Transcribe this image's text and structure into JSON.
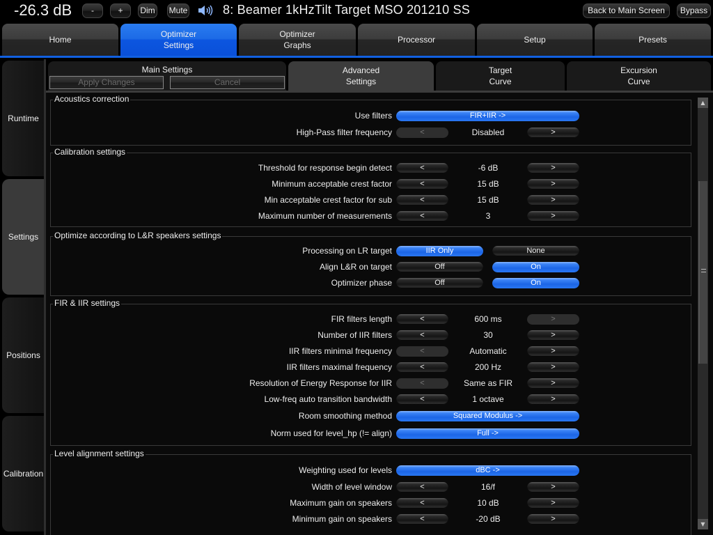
{
  "topbar": {
    "volume": "-26.3 dB",
    "minus_label": "-",
    "plus_label": "+",
    "dim_label": "Dim",
    "mute_label": "Mute",
    "preset_title": "8: Beamer 1kHzTilt Target MSO 201210 SS",
    "back_label": "Back to Main Screen",
    "bypass_label": "Bypass"
  },
  "main_tabs": [
    {
      "line1": "",
      "line2": "Home"
    },
    {
      "line1": "Optimizer",
      "line2": "Settings"
    },
    {
      "line1": "Optimizer",
      "line2": "Graphs"
    },
    {
      "line1": "",
      "line2": "Processor"
    },
    {
      "line1": "",
      "line2": "Setup"
    },
    {
      "line1": "",
      "line2": "Presets"
    }
  ],
  "side_tabs": [
    "Runtime",
    "Settings",
    "Positions",
    "Calibration"
  ],
  "sub_tabs": {
    "main_settings": "Main Settings",
    "apply_changes": "Apply Changes",
    "cancel": "Cancel",
    "advanced_1": "Advanced",
    "advanced_2": "Settings",
    "target_1": "Target",
    "target_2": "Curve",
    "excursion_1": "Excursion",
    "excursion_2": "Curve"
  },
  "arrows": {
    "prev": "<",
    "next": ">"
  },
  "groups": {
    "acoustics": {
      "title": "Acoustics correction",
      "use_filters": {
        "label": "Use filters",
        "value": "FIR+IIR ->"
      },
      "highpass": {
        "label": "High-Pass filter frequency",
        "value": "Disabled"
      }
    },
    "calibration": {
      "title": "Calibration settings",
      "rows": [
        {
          "label": "Threshold for response begin detect",
          "value": "-6 dB"
        },
        {
          "label": "Minimum acceptable crest factor",
          "value": "15 dB"
        },
        {
          "label": "Min acceptable crest factor for sub",
          "value": "15 dB"
        },
        {
          "label": "Maximum number of measurements",
          "value": "3"
        }
      ]
    },
    "lr": {
      "title": "Optimize according to L&R speakers settings",
      "processing": {
        "label": "Processing on LR target",
        "opt1": "IIR Only",
        "opt2": "None"
      },
      "align": {
        "label": "Align L&R on target",
        "opt1": "Off",
        "opt2": "On"
      },
      "phase": {
        "label": "Optimizer phase",
        "opt1": "Off",
        "opt2": "On"
      }
    },
    "fir_iir": {
      "title": "FIR & IIR settings",
      "rows": [
        {
          "label": "FIR filters length",
          "value": "600 ms"
        },
        {
          "label": "Number of IIR filters",
          "value": "30"
        },
        {
          "label": "IIR filters minimal frequency",
          "value": "Automatic"
        },
        {
          "label": "IIR filters maximal frequency",
          "value": "200 Hz"
        },
        {
          "label": "Resolution of Energy Response for IIR",
          "value": "Same as FIR"
        },
        {
          "label": "Low-freq auto transition bandwidth",
          "value": "1 octave"
        }
      ],
      "smoothing": {
        "label": "Room smoothing method",
        "value": "Squared Modulus ->"
      },
      "norm": {
        "label": "Norm used for level_hp (!= align)",
        "value": "Full ->"
      }
    },
    "level": {
      "title": "Level alignment settings",
      "weighting": {
        "label": "Weighting used for levels",
        "value": "dBC ->"
      },
      "rows": [
        {
          "label": "Width of level window",
          "value": "16/f"
        },
        {
          "label": "Maximum gain on speakers",
          "value": "10 dB"
        },
        {
          "label": "Minimum gain on speakers",
          "value": "-20 dB"
        }
      ]
    }
  },
  "scrollbar": {
    "up": "▲",
    "down": "▼"
  }
}
